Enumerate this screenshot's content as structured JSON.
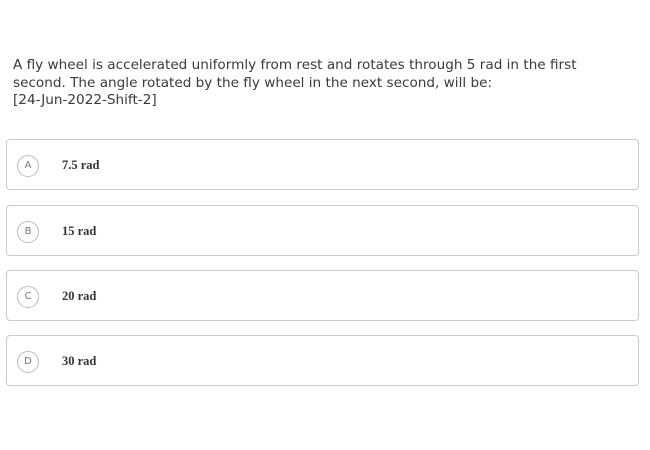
{
  "question": {
    "lines": [
      "A fly wheel is accelerated uniformly from rest and rotates through 5 rad in the first",
      "second. The angle rotated by the fly wheel in the next second, will be:",
      "[24-Jun-2022-Shift-2]"
    ]
  },
  "options": [
    {
      "letter": "A",
      "text": "7.5 rad"
    },
    {
      "letter": "B",
      "text": "15 rad"
    },
    {
      "letter": "C",
      "text": "20 rad"
    },
    {
      "letter": "D",
      "text": "30 rad"
    }
  ]
}
